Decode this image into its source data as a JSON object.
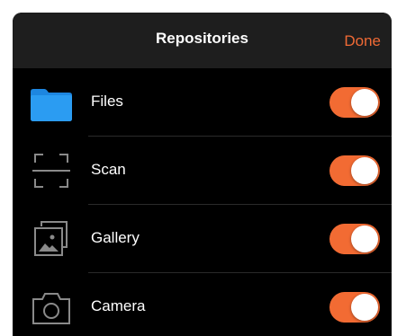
{
  "header": {
    "title": "Repositories",
    "done_label": "Done"
  },
  "colors": {
    "accent": "#f26b33",
    "background": "#000000",
    "header_background": "#1e1e1e",
    "folder_blue": "#2b9cf2"
  },
  "items": [
    {
      "label": "Files",
      "icon": "folder-icon",
      "enabled": true
    },
    {
      "label": "Scan",
      "icon": "scan-frame-icon",
      "enabled": true
    },
    {
      "label": "Gallery",
      "icon": "gallery-icon",
      "enabled": true
    },
    {
      "label": "Camera",
      "icon": "camera-icon",
      "enabled": true
    }
  ]
}
